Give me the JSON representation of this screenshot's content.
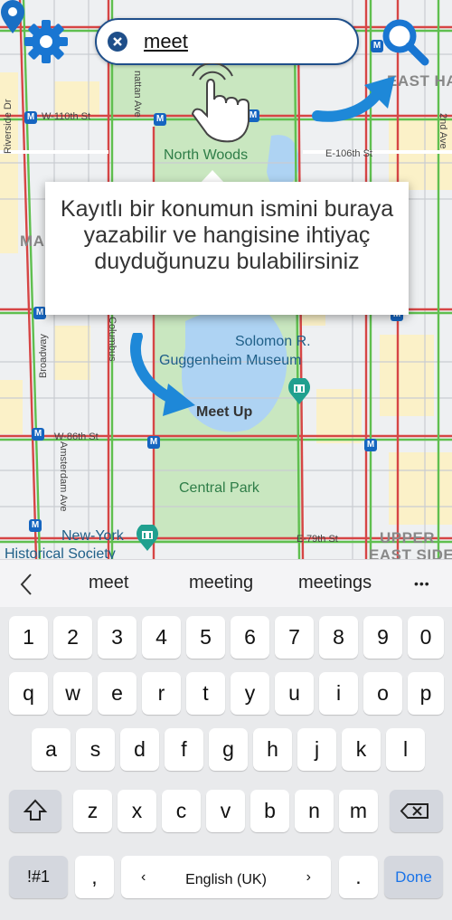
{
  "search": {
    "value": "meet"
  },
  "tooltip": {
    "text": "Kayıtlı bir konumun ismini buraya yazabilir ve hangisine ihtiyaç duyduğunuzu bulabilirsiniz"
  },
  "map": {
    "labels": {
      "north_woods": "North Woods",
      "solomon": "Solomon R.",
      "guggenheim": "Guggenheim Museum",
      "meet_up": "Meet Up",
      "central_park": "Central Park",
      "new_york": "New-York",
      "historical_society": "Historical Society",
      "upper": "UPPER",
      "east_side": "EAST SIDE",
      "east_ha": "EAST HA",
      "ma": "MA",
      "w110": "W-110th St",
      "w86": "W-86th St",
      "e79": "E-79th St",
      "e106": "E-106th St",
      "amsterdam": "Amsterdam Ave",
      "broadway": "Broadway",
      "columbus": "Columbus",
      "riverside": "Riverside Dr",
      "second_ave": "2nd Ave",
      "manhattan": "nattan Ave"
    },
    "metro": "M"
  },
  "keyboard": {
    "suggestions": [
      "meet",
      "meeting",
      "meetings"
    ],
    "more": "•••",
    "numbers": [
      "1",
      "2",
      "3",
      "4",
      "5",
      "6",
      "7",
      "8",
      "9",
      "0"
    ],
    "row1": [
      "q",
      "w",
      "e",
      "r",
      "t",
      "y",
      "u",
      "i",
      "o",
      "p"
    ],
    "row2": [
      "a",
      "s",
      "d",
      "f",
      "g",
      "h",
      "j",
      "k",
      "l"
    ],
    "row3": [
      "z",
      "x",
      "c",
      "v",
      "b",
      "n",
      "m"
    ],
    "symbols": "!#1",
    "comma": ",",
    "language": "English (UK)",
    "period": ".",
    "done": "Done"
  }
}
